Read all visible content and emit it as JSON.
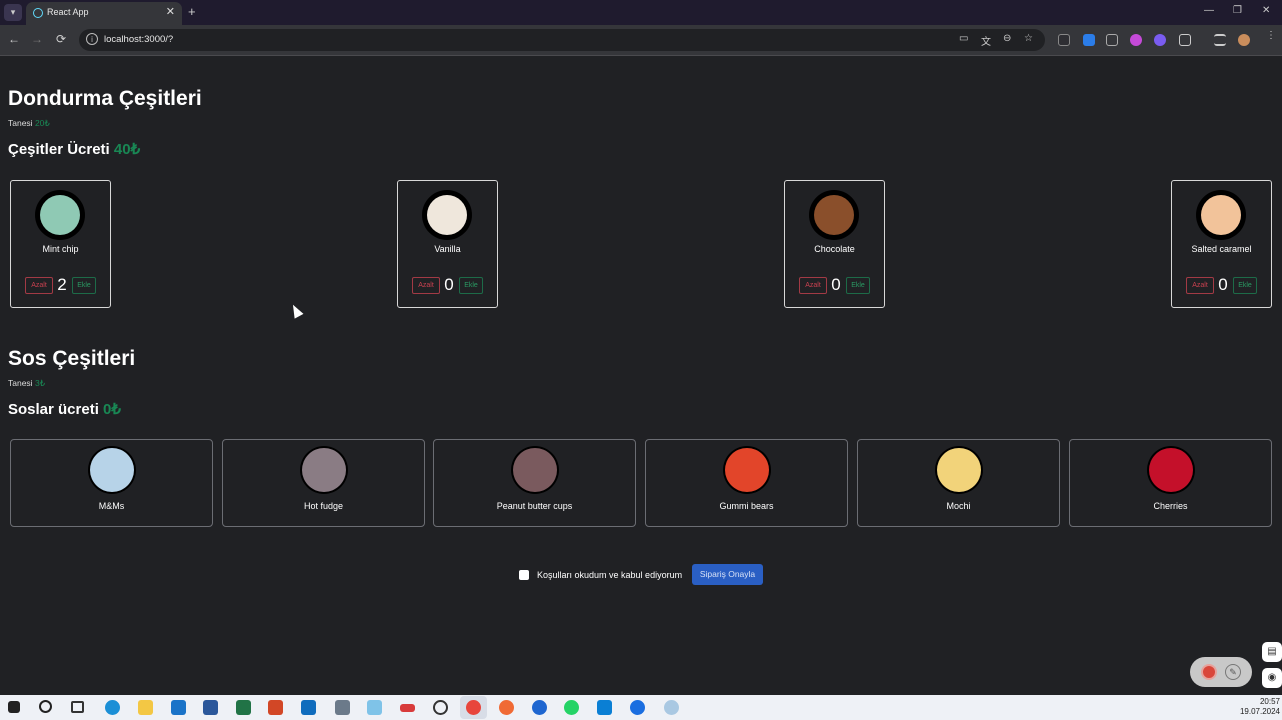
{
  "browser": {
    "tab_title": "React App",
    "close_glyph": "✕",
    "newtab_glyph": "+",
    "url": "localhost:3000/?",
    "back": "←",
    "forward": "→",
    "reload": "⟳",
    "win_min": "—",
    "win_max": "❐",
    "win_close": "✕"
  },
  "ice": {
    "title": "Dondurma Çeşitleri",
    "unit_label": "Tanesi",
    "unit_price": "20₺",
    "total_label": "Çeşitler Ücreti",
    "total_value": "40₺",
    "items": [
      {
        "name": "Mint chip",
        "count": "2",
        "minus": "Azalt",
        "plus": "Ekle",
        "color": "#8fc9b4"
      },
      {
        "name": "Vanilla",
        "count": "0",
        "minus": "Azalt",
        "plus": "Ekle",
        "color": "#efe7dc"
      },
      {
        "name": "Chocolate",
        "count": "0",
        "minus": "Azalt",
        "plus": "Ekle",
        "color": "#8a4f2b"
      },
      {
        "name": "Salted caramel",
        "count": "0",
        "minus": "Azalt",
        "plus": "Ekle",
        "color": "#f2c39a"
      }
    ]
  },
  "sauce": {
    "title": "Sos Çeşitleri",
    "unit_label": "Tanesi",
    "unit_price": "3₺",
    "total_label": "Soslar ücreti",
    "total_value": "0₺",
    "items": [
      {
        "name": "M&Ms",
        "color": "#b7d3e8"
      },
      {
        "name": "Hot fudge",
        "color": "#8a7c84"
      },
      {
        "name": "Peanut butter cups",
        "color": "#7a5a5e"
      },
      {
        "name": "Gummi bears",
        "color": "#e2452a"
      },
      {
        "name": "Mochi",
        "color": "#f2d37a"
      },
      {
        "name": "Cherries",
        "color": "#c4102a"
      }
    ]
  },
  "order": {
    "terms_label": "Koşulları okudum ve kabul ediyorum",
    "confirm_label": "Sipariş Onayla"
  },
  "taskbar": {
    "time": "20:57",
    "date": "19.07.2024"
  }
}
